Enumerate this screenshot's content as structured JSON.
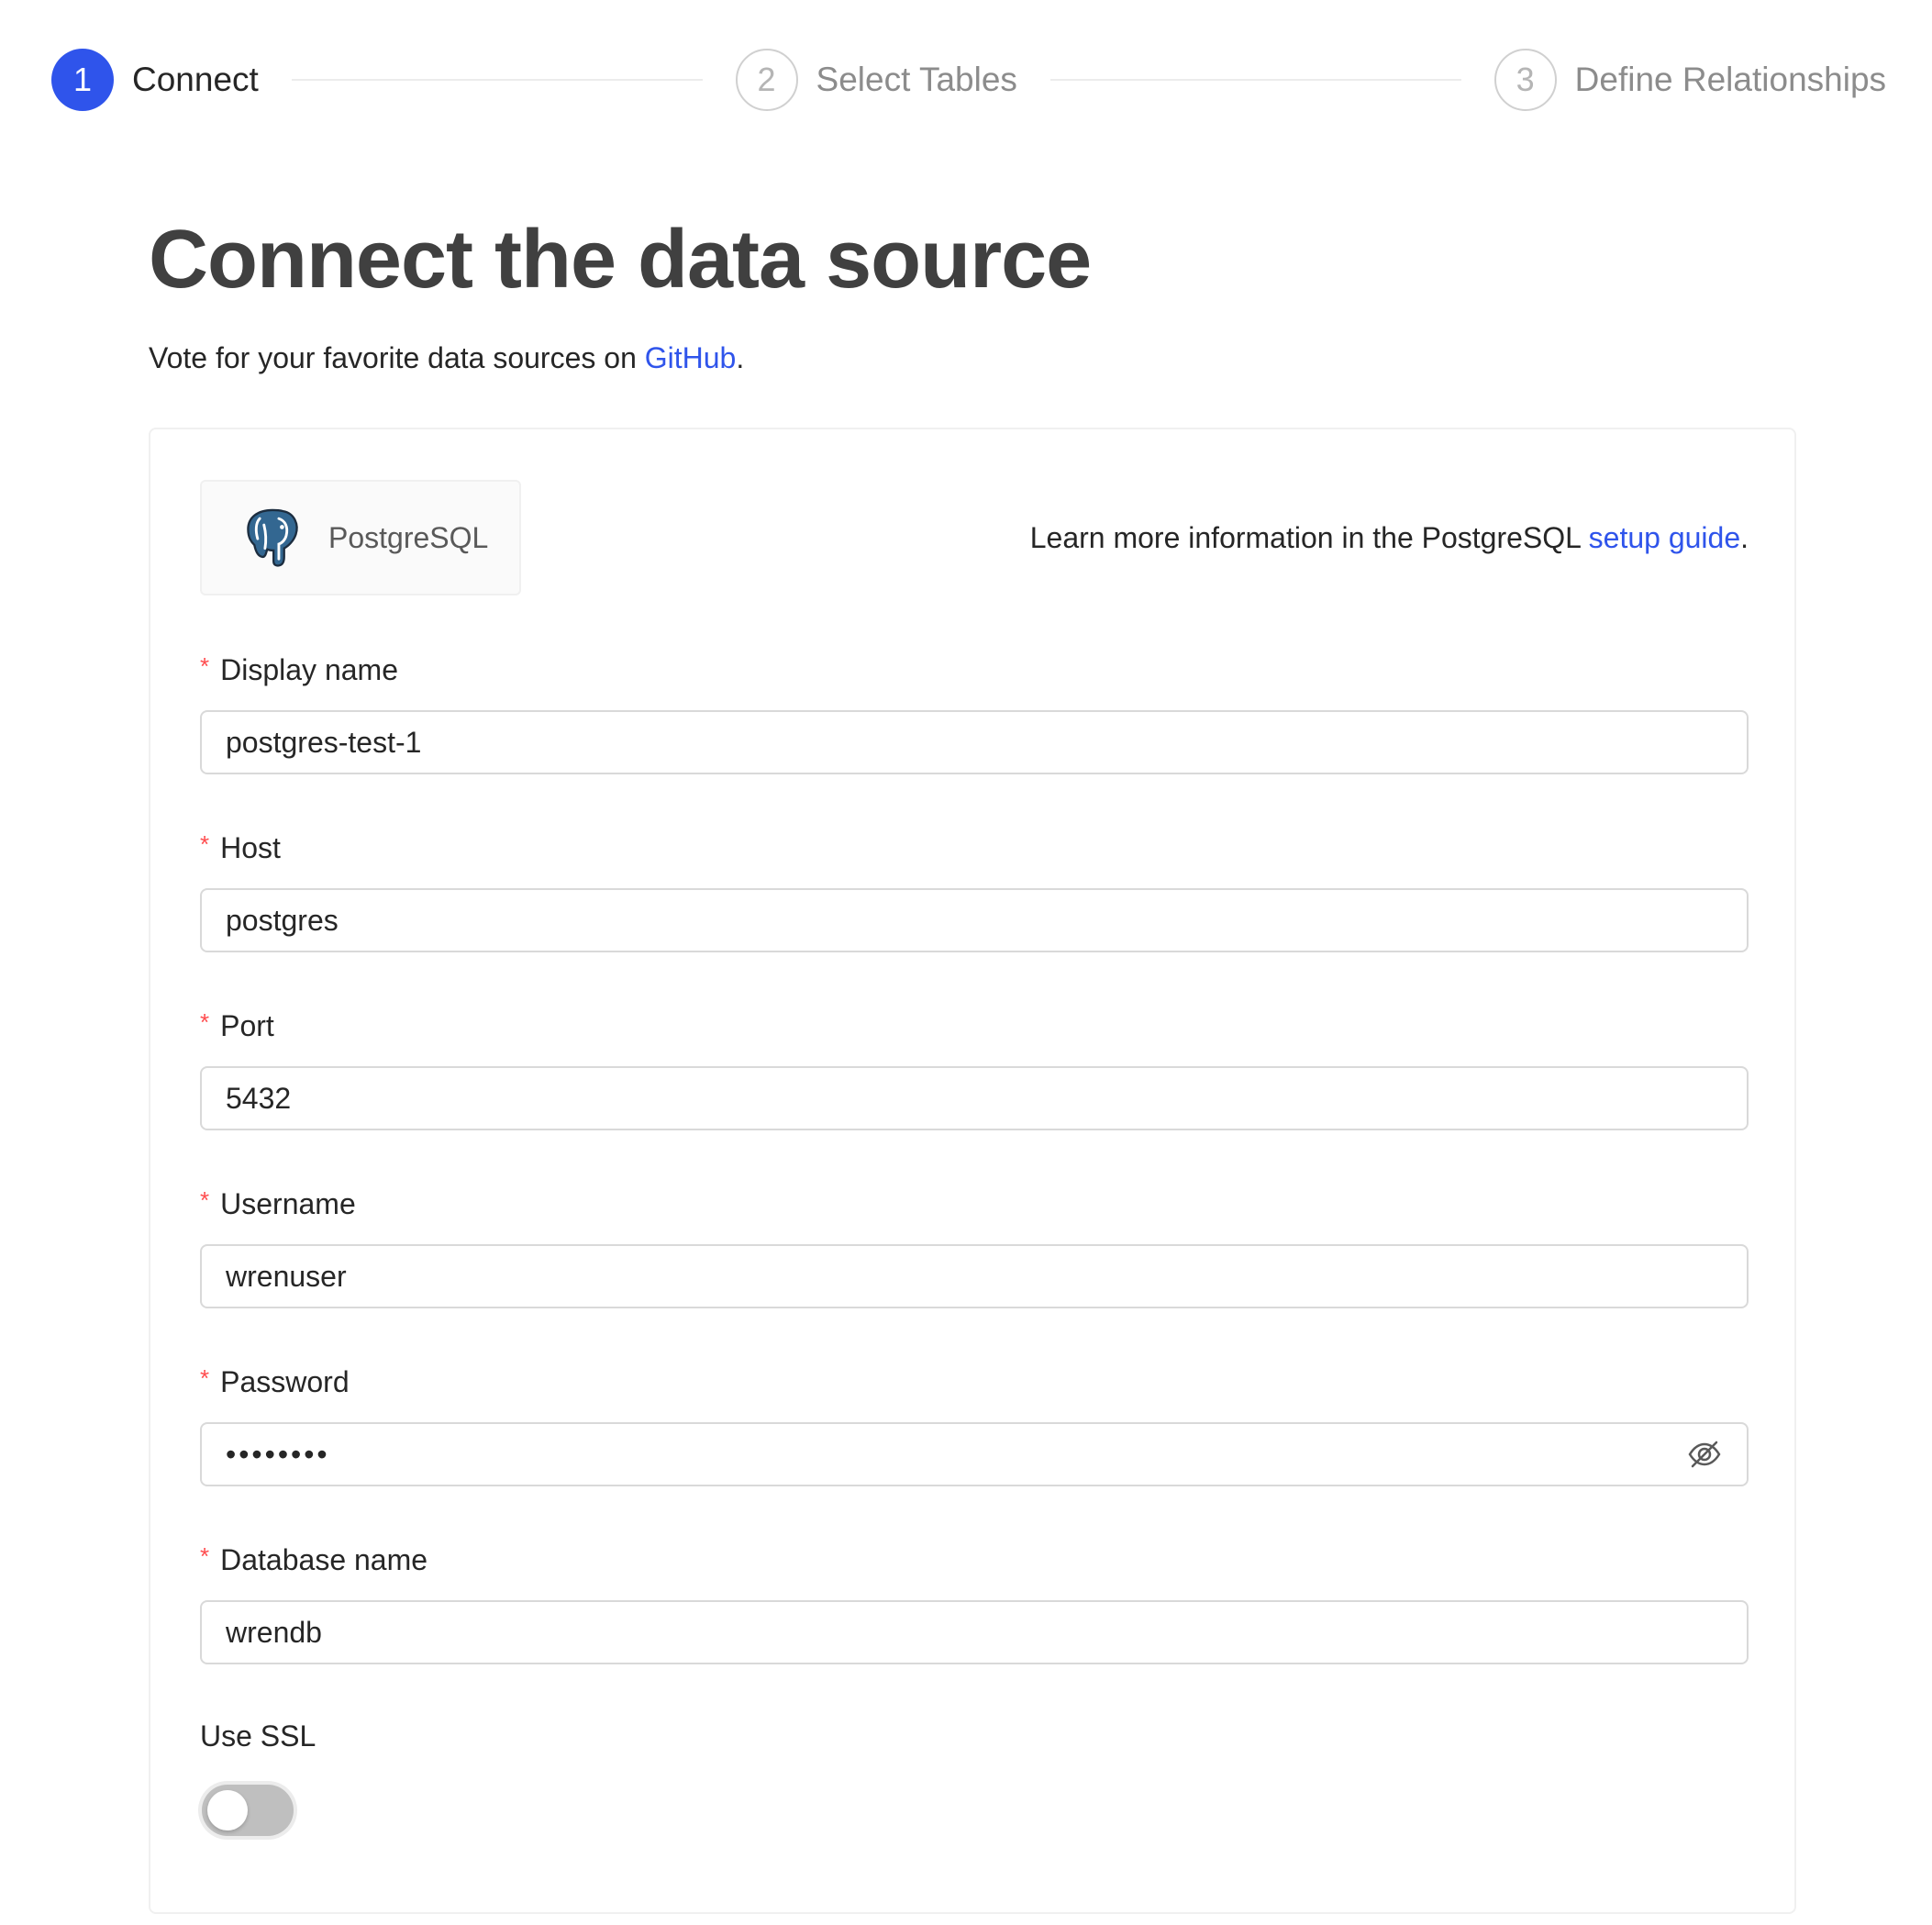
{
  "steps": [
    {
      "number": "1",
      "title": "Connect",
      "state": "active"
    },
    {
      "number": "2",
      "title": "Select Tables",
      "state": "inactive"
    },
    {
      "number": "3",
      "title": "Define Relationships",
      "state": "inactive"
    }
  ],
  "header": {
    "title": "Connect the data source",
    "subtitle_prefix": "Vote for your favorite data sources on ",
    "subtitle_link": "GitHub",
    "subtitle_suffix": "."
  },
  "source": {
    "name": "PostgreSQL",
    "icon": "postgresql-elephant-icon",
    "learn_more_prefix": "Learn more information in the PostgreSQL ",
    "learn_more_link": "setup guide",
    "learn_more_suffix": "."
  },
  "form": {
    "required_mark": "*",
    "display_name": {
      "label": "Display name",
      "value": "postgres-test-1"
    },
    "host": {
      "label": "Host",
      "value": "postgres"
    },
    "port": {
      "label": "Port",
      "value": "5432"
    },
    "username": {
      "label": "Username",
      "value": "wrenuser"
    },
    "password": {
      "label": "Password",
      "value": "••••••••",
      "icon": "eye-invisible-icon"
    },
    "database_name": {
      "label": "Database name",
      "value": "wrendb"
    },
    "use_ssl": {
      "label": "Use SSL",
      "checked": false
    }
  },
  "colors": {
    "primary": "#2f54eb",
    "required": "#ff4d4f",
    "toggle_off": "#bfbfbf"
  }
}
